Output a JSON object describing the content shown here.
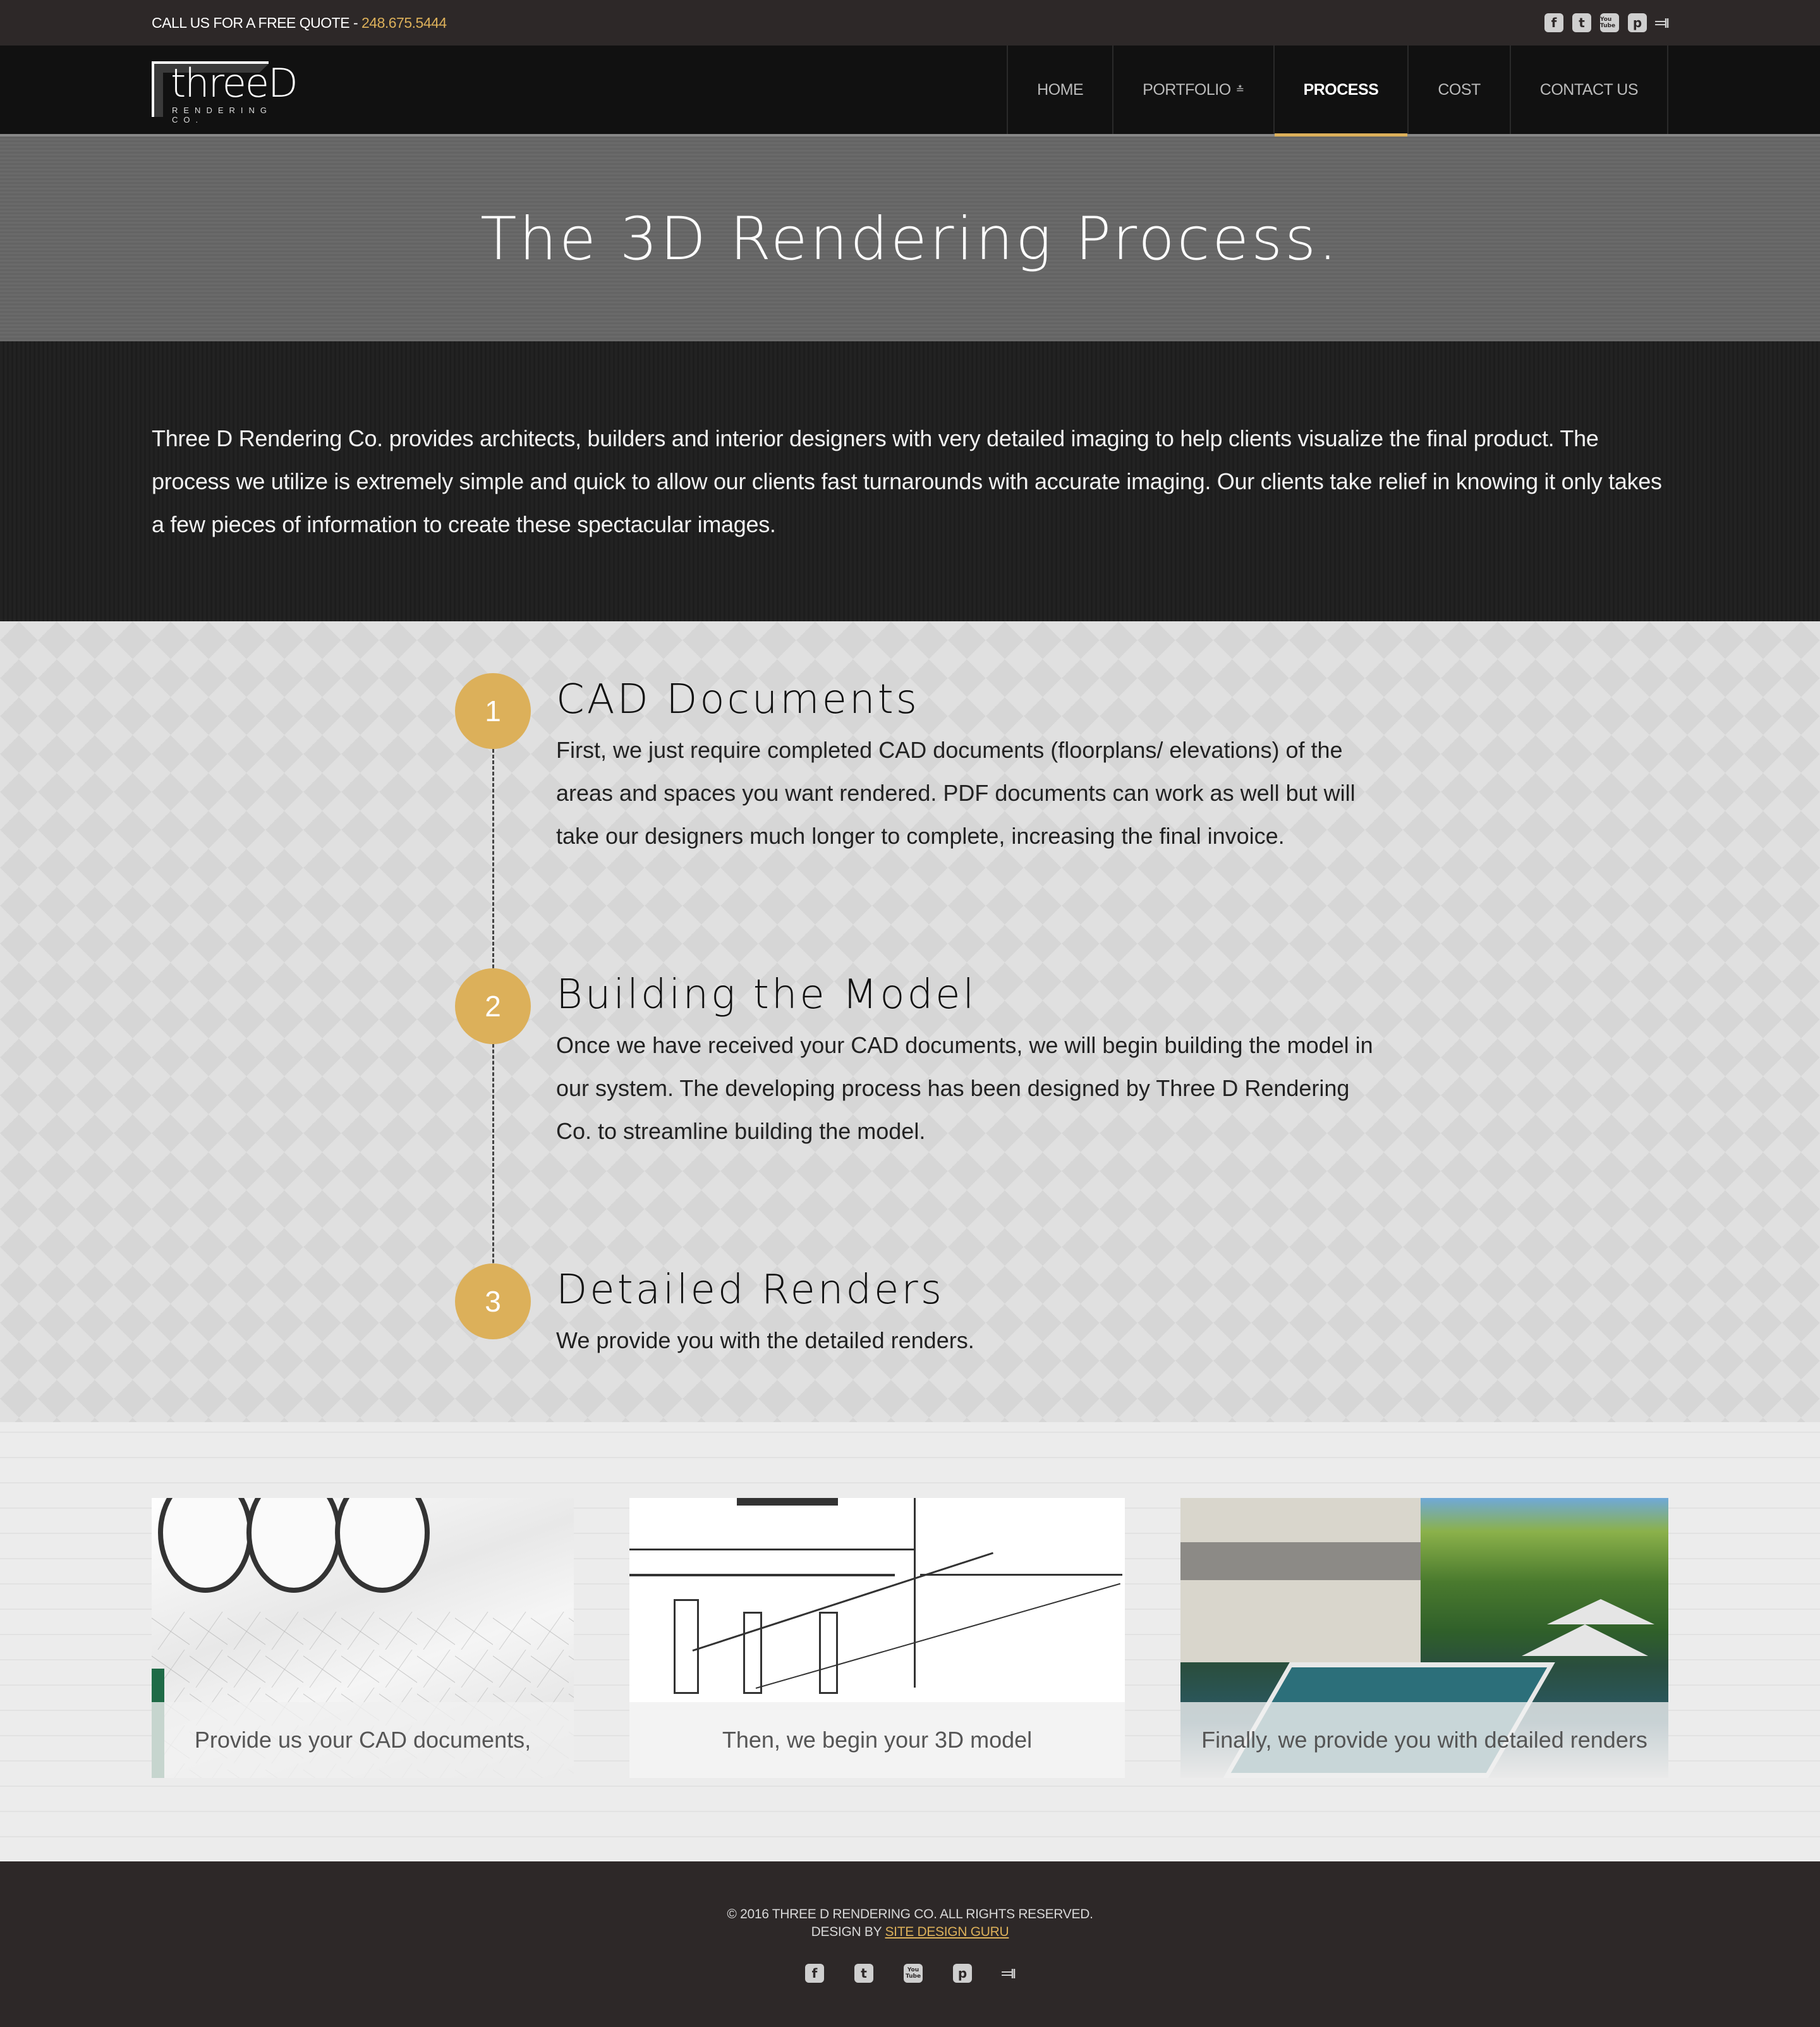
{
  "topbar": {
    "call_text": "CALL US FOR A FREE QUOTE - ",
    "phone": "248.675.5444",
    "social": [
      {
        "name": "facebook",
        "glyph": "f"
      },
      {
        "name": "twitter",
        "glyph": "t"
      },
      {
        "name": "youtube",
        "glyph": "You Tube"
      },
      {
        "name": "pinterest",
        "glyph": "p"
      },
      {
        "name": "houzz",
        "glyph": "h"
      }
    ]
  },
  "logo": {
    "main": "threeD",
    "sub": "RENDERING CO."
  },
  "nav": {
    "items": [
      {
        "label": "HOME",
        "active": false
      },
      {
        "label": "PORTFOLIO",
        "active": false,
        "has_dropdown": true,
        "chevron": "»"
      },
      {
        "label": "PROCESS",
        "active": true
      },
      {
        "label": "COST",
        "active": false
      },
      {
        "label": "CONTACT US",
        "active": false
      }
    ]
  },
  "hero": {
    "title": "The 3D Rendering Process."
  },
  "intro": {
    "text": "Three D Rendering Co. provides architects, builders and interior designers with very detailed imaging to help clients visualize the final product. The process we utilize is extremely simple and quick to allow our clients fast turnarounds with accurate imaging. Our clients take relief in knowing it only takes a few pieces of information to create these spectacular images."
  },
  "steps": [
    {
      "number": "1",
      "title": "CAD Documents",
      "text": "First, we just require completed CAD documents (floorplans/ elevations) of the areas and spaces you want rendered.   PDF documents can work as well but will take our designers much longer to complete, increasing the final invoice."
    },
    {
      "number": "2",
      "title": "Building the Model",
      "text": "Once we have received your CAD documents, we will begin building the model in our system. The developing process has been designed by Three D Rendering Co. to streamline building the model."
    },
    {
      "number": "3",
      "title": "Detailed Renders",
      "text": "We provide you with the detailed renders."
    }
  ],
  "cards": [
    {
      "caption": "Provide us your CAD documents,",
      "image": "blueprint-rolls"
    },
    {
      "caption": "Then, we begin your 3D model",
      "image": "sketch-model"
    },
    {
      "caption": "Finally, we provide you with detailed renders",
      "image": "pool-render"
    }
  ],
  "footer": {
    "copyright": "© 2016 THREE D RENDERING CO. ALL RIGHTS RESERVED.",
    "design_by": "DESIGN BY ",
    "designer_link": "SITE DESIGN GURU"
  },
  "colors": {
    "accent": "#dcb05a",
    "topbar_bg": "#2d2828",
    "nav_bg": "#111111",
    "footer_bg": "#2d2828"
  }
}
